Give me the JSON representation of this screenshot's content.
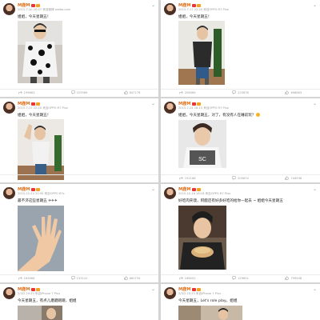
{
  "posts": [
    {
      "user": "M鹿M",
      "meta": "2015-7-10 20:07 来自微博 weibo.com",
      "text": "姐姐，今天星期五！",
      "shares": "199683",
      "comments": "225589",
      "likes": "647176"
    },
    {
      "user": "M鹿M",
      "meta": "2015-7-17 22:20 来自OPPO R7 Plus",
      "text": "姐姐，今天星期五！",
      "shares": "206469",
      "comments": "225876",
      "likes": "696863"
    },
    {
      "user": "M鹿M",
      "meta": "2015-7-17 22:20 来自OPPO R7 Plus",
      "text": "姐姐，今天星期五！",
      "shares": "",
      "comments": "",
      "likes": ""
    },
    {
      "user": "M鹿M",
      "meta": "2015-7-24 18:15 来自OPPO R7 Plus",
      "text": "姐姐，今天星期五，对了，有没有人在睡前玩？",
      "shares": "192186",
      "comments": "205674",
      "likes": "744936"
    },
    {
      "user": "M鹿M",
      "meta": "2015-10-23 20:30 来自OPPO R7s",
      "text": "最不济这些星期五 ✈✈✈",
      "shares": "163466",
      "comments": "133141",
      "likes": "660734"
    },
    {
      "user": "M鹿M",
      "meta": "2015-10-16 18:18 来自OPPO R7 Plus",
      "text": "好吃肉夹馍，阿鹿还有好多好吃的给你一起去 ~ 姐姐今天星期五",
      "shares": "166002",
      "comments": "129601",
      "likes": "799948"
    },
    {
      "user": "M鹿M",
      "meta": "2/3/2 20:23 来自iPhone 7 Plus",
      "text": "今天星期五，有点儿磨磨蹭蹭，姐姐"
    },
    {
      "user": "M鹿M",
      "meta": "2/3/2 20:23 来自iPhone 7 Plus",
      "text": "今天星期五，Let's role play，姐姐"
    }
  ],
  "colors": {
    "username": "#e0701a",
    "meta": "#9a9a9a",
    "text": "#222222",
    "background": "#d4d4d4",
    "card": "#ffffff"
  },
  "icons": {
    "share": "share-icon",
    "comment": "comment-icon",
    "like": "like-icon",
    "chevron": "chevron-down-icon"
  }
}
